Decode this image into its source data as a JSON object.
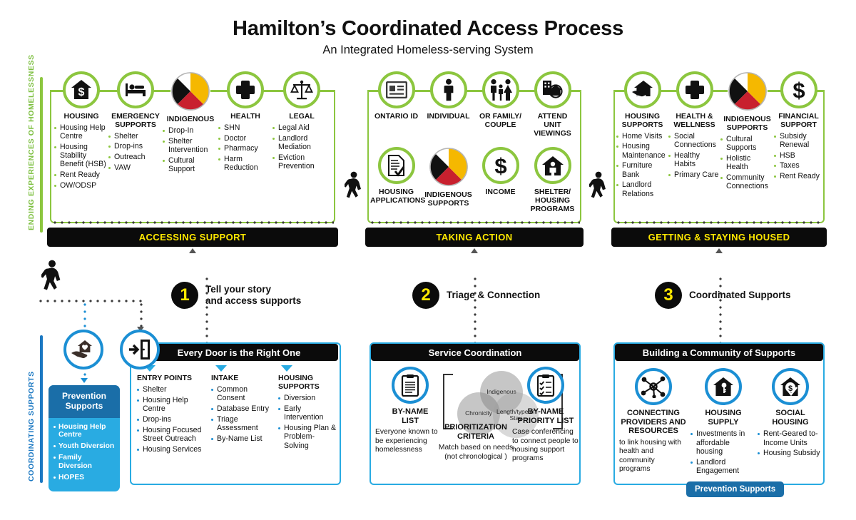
{
  "title": "Hamilton’s Coordinated Access Process",
  "subtitle": "An Integrated Homeless-serving System",
  "rails": {
    "top": "ENDING EXPERIENCES OF HOMELESSNESS",
    "bottom": "COORDINATING SUPPORTS"
  },
  "banners": {
    "stage1": "ACCESSING SUPPORT",
    "stage2": "TAKING ACTION",
    "stage3": "GETTING & STAYING HOUSED"
  },
  "steps": [
    {
      "number": "1",
      "label": "Tell your story\nand access supports"
    },
    {
      "number": "2",
      "label": "Triage & Connection"
    },
    {
      "number": "3",
      "label": "Coordinated Supports"
    }
  ],
  "stage1": {
    "columns": [
      {
        "icon": "house-dollar-icon",
        "title": "HOUSING",
        "items": [
          "Housing Help Centre",
          "Housing Stability Benefit (HSB)",
          "Rent Ready",
          "OW/ODSP"
        ]
      },
      {
        "icon": "bed-icon",
        "title": "EMERGENCY SUPPORTS",
        "items": [
          "Shelter",
          "Drop-ins",
          "Outreach",
          "VAW"
        ]
      },
      {
        "icon": "medicine-wheel-icon",
        "title": "INDIGENOUS",
        "items": [
          "Drop-In",
          "Shelter Intervention",
          "Cultural Support"
        ]
      },
      {
        "icon": "medical-cross-icon",
        "title": "HEALTH",
        "items": [
          "SHN",
          "Doctor",
          "Pharmacy",
          "Harm Reduction"
        ]
      },
      {
        "icon": "scales-of-justice-icon",
        "title": "LEGAL",
        "items": [
          "Legal Aid",
          "Landlord Mediation",
          "Eviction Prevention"
        ]
      }
    ]
  },
  "stage2": {
    "row1": [
      {
        "icon": "id-card-icon",
        "title": "ONTARIO ID"
      },
      {
        "icon": "individual-person-icon",
        "title": "INDIVIDUAL"
      },
      {
        "icon": "family-couple-icon",
        "title": "OR  FAMILY/\nCOUPLE"
      },
      {
        "icon": "building-magnifier-icon",
        "title": "ATTEND\nUNIT VIEWINGS"
      }
    ],
    "row2": [
      {
        "icon": "document-check-icon",
        "title": "HOUSING\nAPPLICATIONS"
      },
      {
        "icon": "medicine-wheel-icon",
        "title": "INDIGENOUS\nSUPPORTS"
      },
      {
        "icon": "dollar-sign-icon",
        "title": "INCOME"
      },
      {
        "icon": "house-person-icon",
        "title": "SHELTER/\nHOUSING\nPROGRAMS"
      }
    ]
  },
  "stage3": {
    "columns": [
      {
        "icon": "hand-house-icon",
        "title": "HOUSING SUPPORTS",
        "items": [
          "Home Visits",
          "Housing Maintenance",
          "Furniture Bank",
          "Landlord Relations"
        ]
      },
      {
        "icon": "medical-cross-icon",
        "title": "HEALTH & WELLNESS",
        "items": [
          "Social Connections",
          "Healthy Habits",
          "Primary Care"
        ]
      },
      {
        "icon": "medicine-wheel-icon",
        "title": "INDIGENOUS SUPPORTS",
        "items": [
          "Cultural Supports",
          "Holistic Health",
          "Community Connections"
        ]
      },
      {
        "icon": "dollar-sign-icon",
        "title": "FINANCIAL SUPPORT",
        "items": [
          "Subsidy Renewal",
          "HSB",
          "Taxes",
          "Rent Ready"
        ]
      }
    ]
  },
  "prevention": {
    "icon": "hand-heart-house-icon",
    "title": "Prevention\nSupports",
    "items": [
      "Housing Help Centre",
      "Youth Diversion",
      "Family Diversion",
      "HOPES"
    ],
    "badge": "Prevention Supports"
  },
  "panel1": {
    "icon": "door-entry-icon",
    "heading": "Every Door is the Right One",
    "columns": [
      {
        "title": "ENTRY POINTS",
        "items": [
          "Shelter",
          "Housing Help Centre",
          "Drop-ins",
          "Housing Focused Street Outreach",
          "Housing Services"
        ]
      },
      {
        "title": "INTAKE",
        "items": [
          "Common Consent",
          "Database Entry",
          "Triage Assessment",
          "By-Name List"
        ]
      },
      {
        "title": "HOUSING SUPPORTS",
        "items": [
          "Diversion",
          "Early Intervention",
          "Housing Plan & Problem-Solving"
        ]
      }
    ]
  },
  "panel2": {
    "heading": "Service Coordination",
    "left": {
      "icon": "clipboard-list-icon",
      "label": "BY-NAME\nLIST",
      "desc": "Everyone known to be experiencing homelessness"
    },
    "middle": {
      "label": "PRIORITIZATION\nCRITERIA",
      "desc": "Match based on needs\n(not chronological )",
      "venn": [
        "Indigenous",
        "Chronicity",
        "Length/type of Stay"
      ]
    },
    "right": {
      "icon": "clipboard-check-icon",
      "label": "BY-NAME\nPRIORITY LIST",
      "desc": "Case conferencing to connect people to housing support programs"
    }
  },
  "panel3": {
    "heading": "Building a Community of Supports",
    "columns": [
      {
        "icon": "network-nodes-icon",
        "title": "CONNECTING\nPROVIDERS AND\nRESOURCES",
        "desc": "to link housing with health and community programs",
        "items": []
      },
      {
        "icon": "house-key-icon",
        "title": "HOUSING SUPPLY",
        "desc": "",
        "items": [
          "Investments in affordable housing",
          "Landlord Engagement"
        ]
      },
      {
        "icon": "house-dollar-check-icon",
        "title": "SOCIAL HOUSING",
        "desc": "",
        "items": [
          "Rent-Geared to-Income Units",
          "Housing Subsidy"
        ]
      }
    ]
  },
  "colors": {
    "green": "#8cc63f",
    "blue": "#29abe2",
    "dark_blue": "#1a6ea8",
    "yellow": "#ffe800",
    "black": "#0b0b0b",
    "wheel_red": "#c8202e",
    "wheel_yellow": "#f5b800"
  }
}
